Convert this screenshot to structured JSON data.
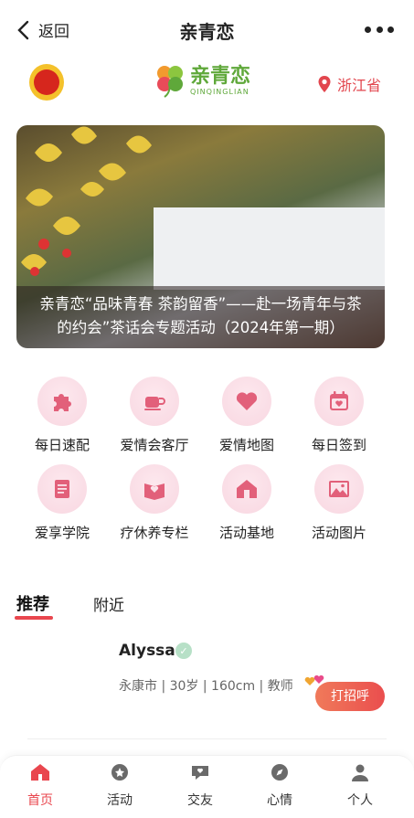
{
  "nav": {
    "back_label": "返回",
    "title": "亲青恋"
  },
  "brand": {
    "logo_cn": "亲青恋",
    "logo_en": "QINQINGLIAN",
    "location": "浙江省"
  },
  "banner": {
    "caption_line1": "亲青恋“品味青春 茶韵留香”——赴一场青年与茶",
    "caption_line2": "的约会”茶话会专题活动（2024年第一期）"
  },
  "features": [
    {
      "label": "每日速配",
      "icon": "puzzle-icon"
    },
    {
      "label": "爱情会客厅",
      "icon": "cup-icon"
    },
    {
      "label": "爱情地图",
      "icon": "heart-icon"
    },
    {
      "label": "每日签到",
      "icon": "calendar-icon"
    },
    {
      "label": "爱享学院",
      "icon": "scroll-icon"
    },
    {
      "label": "疗休养专栏",
      "icon": "book-heart-icon"
    },
    {
      "label": "活动基地",
      "icon": "house-icon"
    },
    {
      "label": "活动图片",
      "icon": "picture-icon"
    }
  ],
  "tabs": {
    "recommend": "推荐",
    "nearby": "附近"
  },
  "profile": {
    "name": "Alyssa",
    "info": "永康市 | 30岁 | 160cm | 教师",
    "greet_label": "打招呼"
  },
  "tabbar": [
    {
      "label": "首页",
      "icon": "home-icon"
    },
    {
      "label": "活动",
      "icon": "activity-icon"
    },
    {
      "label": "交友",
      "icon": "chat-icon"
    },
    {
      "label": "心情",
      "icon": "compass-icon"
    },
    {
      "label": "个人",
      "icon": "person-icon"
    }
  ],
  "colors": {
    "accent": "#e9464e",
    "brand_green": "#5fa83a",
    "icon_pink": "#e2607a"
  }
}
